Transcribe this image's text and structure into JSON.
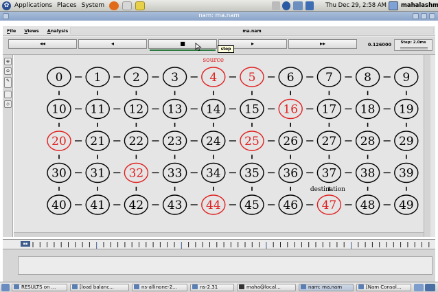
{
  "top_panel": {
    "menus": [
      "Applications",
      "Places",
      "System"
    ],
    "clock": "Thu Dec 29,  2:58 AM",
    "username": "mahalashmi"
  },
  "window": {
    "title": "nam: ma.nam"
  },
  "nam": {
    "menus": [
      "File",
      "Views",
      "Analysis"
    ],
    "filename": "ma.nam",
    "controls": {
      "rewind": "◂◂",
      "back": "◂",
      "stop": "■",
      "play": "▸",
      "fast_forward": "▸▸",
      "stop_tooltip": "stop"
    },
    "sim_time": "0.126000",
    "step_label": "Step: 2.0ms",
    "play_progress": 0.25
  },
  "network": {
    "highlight_color": "#e02020",
    "normal_color": "#000000",
    "labels": {
      "source": "source",
      "destination": "destination"
    },
    "rows": [
      [
        {
          "id": "0",
          "highlight": false
        },
        {
          "id": "1",
          "highlight": false
        },
        {
          "id": "2",
          "highlight": false
        },
        {
          "id": "3",
          "highlight": false
        },
        {
          "id": "4",
          "highlight": true
        },
        {
          "id": "5",
          "highlight": true
        },
        {
          "id": "6",
          "highlight": false
        },
        {
          "id": "7",
          "highlight": false
        },
        {
          "id": "8",
          "highlight": false
        },
        {
          "id": "9",
          "highlight": false
        }
      ],
      [
        {
          "id": "10",
          "highlight": false
        },
        {
          "id": "11",
          "highlight": false
        },
        {
          "id": "12",
          "highlight": false
        },
        {
          "id": "13",
          "highlight": false
        },
        {
          "id": "14",
          "highlight": false
        },
        {
          "id": "15",
          "highlight": false
        },
        {
          "id": "16",
          "highlight": true
        },
        {
          "id": "17",
          "highlight": false
        },
        {
          "id": "18",
          "highlight": false
        },
        {
          "id": "19",
          "highlight": false
        }
      ],
      [
        {
          "id": "20",
          "highlight": true
        },
        {
          "id": "21",
          "highlight": false
        },
        {
          "id": "22",
          "highlight": false
        },
        {
          "id": "23",
          "highlight": false
        },
        {
          "id": "24",
          "highlight": false
        },
        {
          "id": "25",
          "highlight": true
        },
        {
          "id": "26",
          "highlight": false
        },
        {
          "id": "27",
          "highlight": false
        },
        {
          "id": "28",
          "highlight": false
        },
        {
          "id": "29",
          "highlight": false
        }
      ],
      [
        {
          "id": "30",
          "highlight": false
        },
        {
          "id": "31",
          "highlight": false
        },
        {
          "id": "32",
          "highlight": true
        },
        {
          "id": "33",
          "highlight": false
        },
        {
          "id": "34",
          "highlight": false
        },
        {
          "id": "35",
          "highlight": false
        },
        {
          "id": "36",
          "highlight": false
        },
        {
          "id": "37",
          "highlight": false
        },
        {
          "id": "38",
          "highlight": false
        },
        {
          "id": "39",
          "highlight": false
        }
      ],
      [
        {
          "id": "40",
          "highlight": false
        },
        {
          "id": "41",
          "highlight": false
        },
        {
          "id": "42",
          "highlight": false
        },
        {
          "id": "43",
          "highlight": false
        },
        {
          "id": "44",
          "highlight": true
        },
        {
          "id": "45",
          "highlight": false
        },
        {
          "id": "46",
          "highlight": false
        },
        {
          "id": "47",
          "highlight": true
        },
        {
          "id": "48",
          "highlight": false
        },
        {
          "id": "49",
          "highlight": false
        }
      ]
    ]
  },
  "taskbar": {
    "items": [
      {
        "label": "RESULTS on ...",
        "icon": "folder-icon"
      },
      {
        "label": "[load balanc...",
        "icon": "folder-icon"
      },
      {
        "label": "ns-allinone-2...",
        "icon": "folder-icon"
      },
      {
        "label": "ns-2.31",
        "icon": "folder-icon"
      },
      {
        "label": "maha@local...",
        "icon": "terminal-icon"
      },
      {
        "label": "nam: ma.nam",
        "icon": "window-icon"
      },
      {
        "label": "[Nam Consol...",
        "icon": "window-icon"
      }
    ]
  }
}
